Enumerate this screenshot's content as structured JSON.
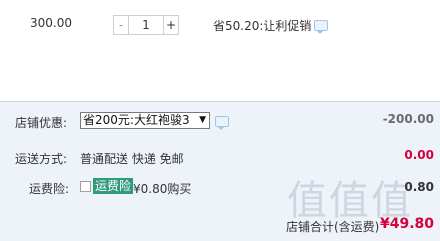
{
  "item": {
    "price": "300.00",
    "quantity": "1",
    "minus_label": "-",
    "plus_label": "+",
    "promo_text": "省50.20:让利促销"
  },
  "summary": {
    "discount_label": "店铺优惠:",
    "discount_selected": "省200元:大红袍骏3",
    "discount_amount": "-200.00",
    "shipping_label": "运送方式:",
    "shipping_value": "普通配送 快递 免邮",
    "shipping_amount": "0.00",
    "insurance_label": "运费险:",
    "insurance_name": "运费险",
    "insurance_price": "¥0.80购买",
    "insurance_amount": "0.80",
    "total_label": "店铺合计(含运费)",
    "total_value": "¥49.80"
  },
  "watermark": "值值值",
  "colors": {
    "price_red": "#d3003a",
    "panel_bg": "#eef3fa",
    "insurance_highlight": "#2e9b7a"
  }
}
